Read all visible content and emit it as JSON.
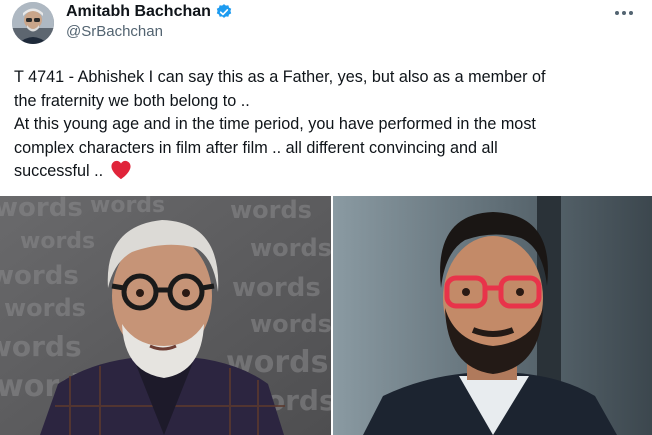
{
  "tweet": {
    "author_name": "Amitabh Bachchan",
    "author_handle": "@SrBachchan",
    "more_icon": "more-horizontal-icon",
    "verified_icon": "verified-badge-icon",
    "text_lines": [
      "T 4741 - Abhishek I can say this as a Father, yes, but also as a member of",
      "the fraternity we both belong to ..",
      "At this young age and in the time period, you have performed in the most",
      "complex characters in film after film .. all different  convincing  and all",
      "successful .. "
    ],
    "heart_icon": "red-heart-emoji",
    "watermark_word": "words"
  },
  "colors": {
    "text": "#0f1419",
    "secondary_text": "#536471",
    "verified_blue": "#1d9bf0",
    "heart_red": "#e0243a"
  }
}
